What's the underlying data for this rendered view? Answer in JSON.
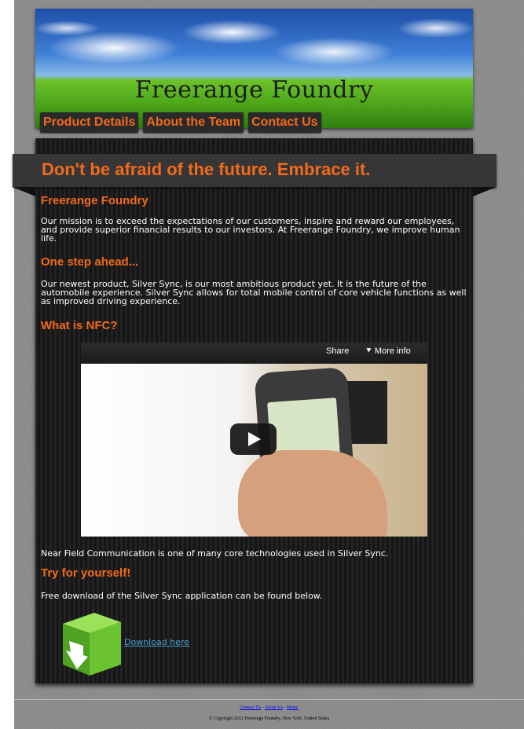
{
  "header": {
    "site_title": "Freerange Foundry",
    "nav": [
      {
        "label": "Product Details"
      },
      {
        "label": "About the Team"
      },
      {
        "label": "Contact Us"
      }
    ]
  },
  "main": {
    "tagline": "Don't be afraid of the future. Embrace it.",
    "sections": [
      {
        "heading": "Freerange Foundry",
        "text": "Our mission is to exceed the expectations of our customers, inspire and reward our employees, and provide superior financial results to our investors. At Freerange Foundry, we improve human life."
      },
      {
        "heading": "One step ahead...",
        "text": "Our newest product, Silver Sync, is our most ambitious product yet. It is the future of the automobile experience. Silver Sync allows for total mobile control of core vehicle functions as well as improved driving experience."
      },
      {
        "heading": "What is NFC?",
        "text": "Near Field Communication is one of many core technologies used in Silver Sync."
      },
      {
        "heading": "Try for yourself!",
        "text": "Free download of the Silver Sync application can be found below."
      }
    ],
    "video": {
      "share_label": "Share",
      "more_info_label": "More info"
    },
    "download": {
      "link_text": "Download here"
    }
  },
  "footer": {
    "links": [
      {
        "label": "Contact Us"
      },
      {
        "label": "About Us"
      },
      {
        "label": "Home"
      }
    ],
    "separator": " - ",
    "copyright": "© Copyright 2012 Freerange Foundry, New York, United States"
  },
  "colors": {
    "accent": "#f26a1b",
    "background": "#8a8a8a",
    "panel": "#1c1c1c"
  }
}
